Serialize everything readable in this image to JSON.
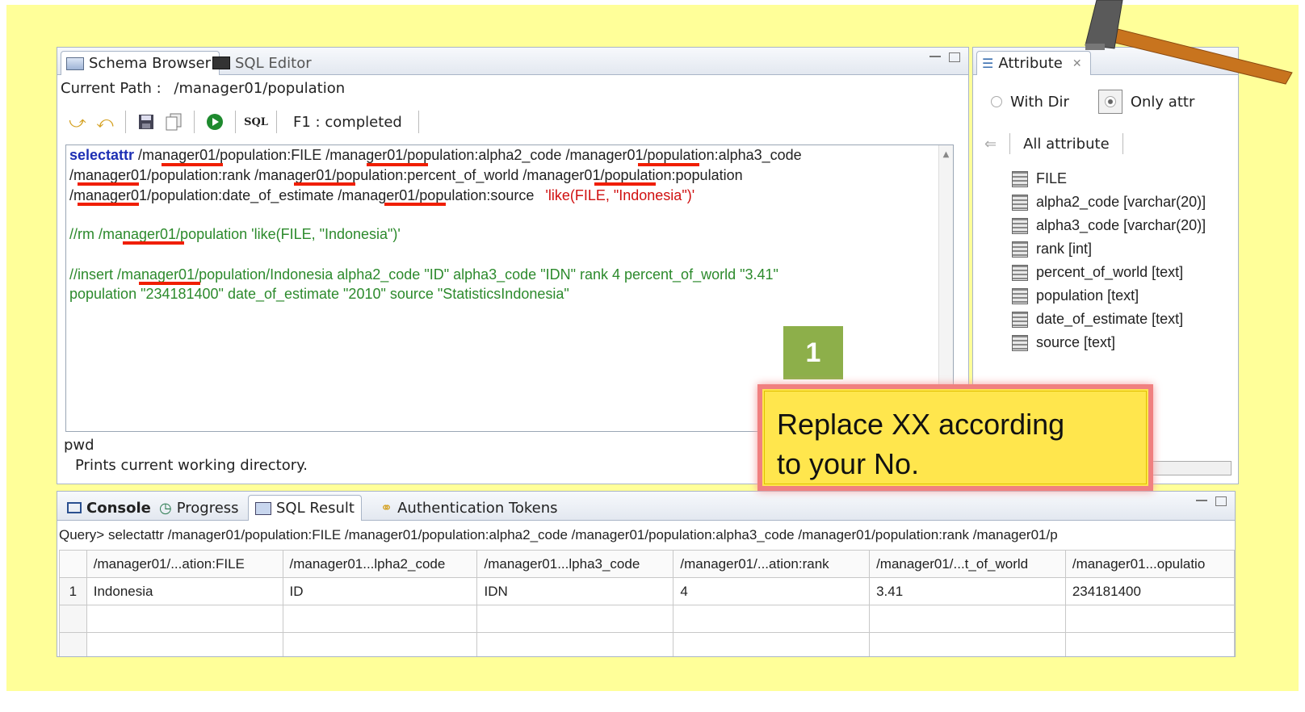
{
  "editor": {
    "tabs": [
      {
        "label": "Schema Browser"
      },
      {
        "label": "SQL Editor"
      }
    ],
    "current_path_label": "Current Path :",
    "current_path_value": "/manager01/population",
    "toolbar": {
      "sql_label": "SQL",
      "status": "F1 : completed"
    },
    "code": {
      "line1_kw": "selectattr",
      "line1_rest": " /manager01/population:FILE /manager01/population:alpha2_code  /manager01/population:alpha3_code",
      "line2": "/manager01/population:rank /manager01/population:percent_of_world  /manager01/population:population",
      "line3_main": "/manager01/population:date_of_estimate  /manager01/population:source",
      "line3_str": "'like(FILE, \"Indonesia\")'",
      "line4": "//rm /manager01/population 'like(FILE, \"Indonesia\")'",
      "line5": "//insert /manager01/population/Indonesia       alpha2_code \"ID\"    alpha3_code \"IDN\" rank 4 percent_of_world \"3.41\"",
      "line6": "population \"234181400\"    date_of_estimate \"2010\"    source \"StatisticsIndonesia\""
    },
    "help": {
      "command": "pwd",
      "description": "Prints current working directory."
    }
  },
  "attribute_panel": {
    "tab_label": "Attribute",
    "with_dir_label": "With Dir",
    "only_attr_label": "Only attr",
    "all_attribute_label": "All attribute",
    "items": [
      {
        "label": "FILE"
      },
      {
        "label": "alpha2_code [varchar(20)]"
      },
      {
        "label": "alpha3_code [varchar(20)]"
      },
      {
        "label": "rank [int]"
      },
      {
        "label": "percent_of_world [text]"
      },
      {
        "label": "population [text]"
      },
      {
        "label": "date_of_estimate [text]"
      },
      {
        "label": "source [text]"
      }
    ]
  },
  "result_panel": {
    "tabs": [
      {
        "label": "Console"
      },
      {
        "label": "Progress"
      },
      {
        "label": "SQL Result"
      },
      {
        "label": "Authentication Tokens"
      }
    ],
    "query": "Query> selectattr /manager01/population:FILE /manager01/population:alpha2_code  /manager01/population:alpha3_code /manager01/population:rank /manager01/p",
    "columns": [
      "/manager01/...ation:FILE",
      "/manager01...lpha2_code",
      "/manager01...lpha3_code",
      "/manager01/...ation:rank",
      "/manager01/...t_of_world",
      "/manager01...opulatio"
    ],
    "rows": [
      {
        "num": "1",
        "cells": [
          "Indonesia",
          "ID",
          "IDN",
          "4",
          "3.41",
          "234181400"
        ]
      }
    ]
  },
  "callout": {
    "number": "1",
    "text_line1": "Replace XX according",
    "text_line2": "to your No."
  },
  "colors": {
    "slide_background": "#ffff99",
    "underline": "#f01e00",
    "badge": "#8daf4a",
    "callout_fill": "#ffe64d",
    "callout_border": "#f08080"
  }
}
